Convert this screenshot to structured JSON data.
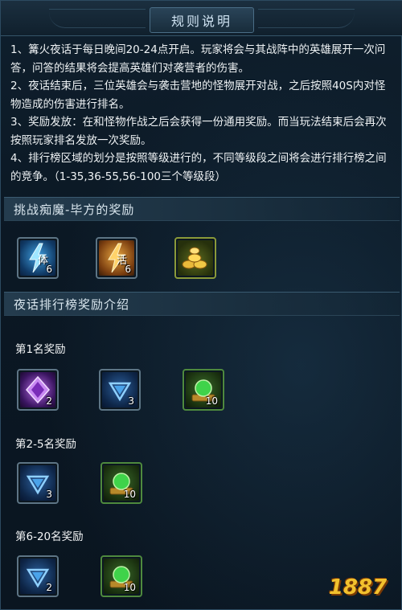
{
  "title": "规则说明",
  "rules": [
    "1、篝火夜话于每日晚间20-24点开启。玩家将会与其战阵中的英雄展开一次问答，问答的结果将会提高英雄们对袭营者的伤害。",
    "2、夜话结束后，三位英雄会与袭击营地的怪物展开对战，之后按照40S内对怪物造成的伤害进行排名。",
    "3、奖励发放：在和怪物作战之后会获得一份通用奖励。而当玩法结束后会再次按照玩家排名发放一次奖励。",
    "4、排行榜区域的划分是按照等级进行的，不同等级段之间将会进行排行榜之间的竞争。（1-35,36-55,56-100三个等级段）"
  ],
  "challenge_section": {
    "title": "挑战痴魔-毕方的奖励",
    "items": [
      {
        "icon": "stamina-lightning-icon",
        "glyph": "体",
        "count": "6"
      },
      {
        "icon": "vitality-lightning-icon",
        "glyph": "活",
        "count": "6"
      },
      {
        "icon": "gold-ingots-icon",
        "glyph": "",
        "count": ""
      }
    ]
  },
  "ranking_section": {
    "title": "夜话排行榜奖励介绍",
    "tiers": [
      {
        "label": "第1名奖励",
        "items": [
          {
            "icon": "purple-gem-icon",
            "count": "2"
          },
          {
            "icon": "blue-diamond-icon",
            "count": "3"
          },
          {
            "icon": "green-orb-icon",
            "count": "10"
          }
        ]
      },
      {
        "label": "第2-5名奖励",
        "items": [
          {
            "icon": "blue-diamond-icon",
            "count": "3"
          },
          {
            "icon": "green-orb-icon",
            "count": "10"
          }
        ]
      },
      {
        "label": "第6-20名奖励",
        "items": [
          {
            "icon": "blue-diamond-icon",
            "count": "2"
          },
          {
            "icon": "green-orb-icon",
            "count": "10"
          }
        ]
      }
    ]
  },
  "watermark": "1887"
}
